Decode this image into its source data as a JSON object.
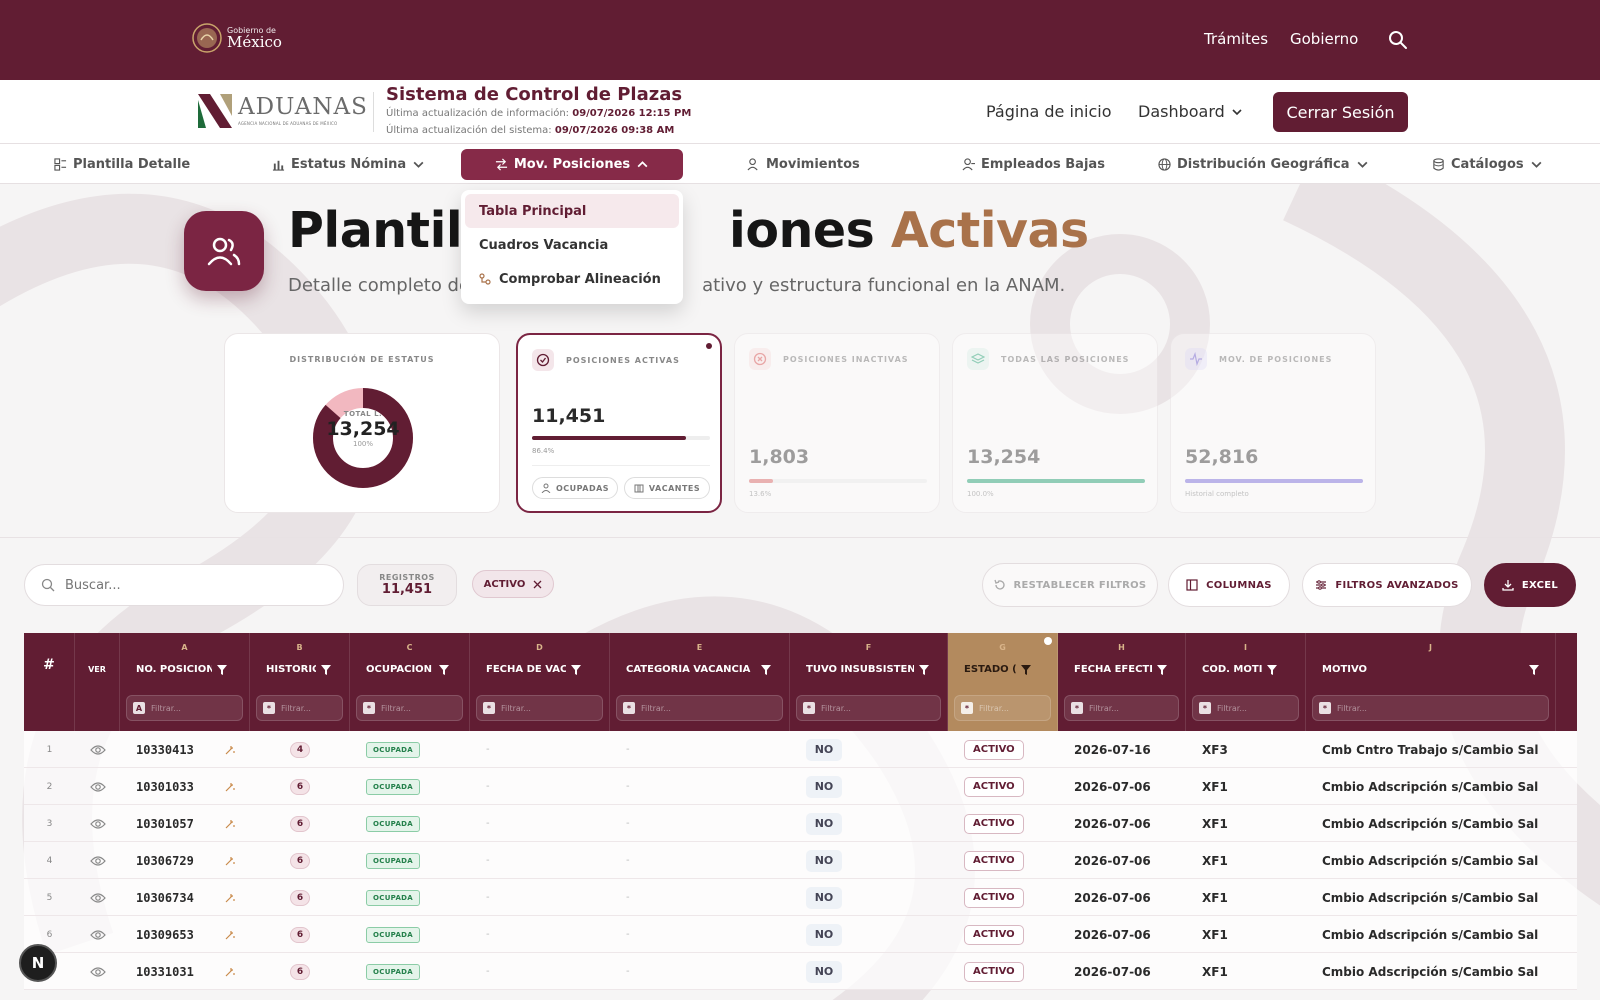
{
  "gov_bar": {
    "logo_small": "Gobierno de",
    "logo_big": "México",
    "links": [
      "Trámites",
      "Gobierno"
    ]
  },
  "header": {
    "logo_word": "ADUANAS",
    "logo_sub": "AGENCIA NACIONAL DE ADUANAS DE MÉXICO",
    "system_title": "Sistema de Control de Plazas",
    "update_info_label": "Última actualización de información:",
    "update_info_value": "09/07/2026 12:15 PM",
    "update_system_label": "Última actualización del sistema:",
    "update_system_value": "09/07/2026 09:38 AM",
    "home_link": "Página de inicio",
    "dashboard_link": "Dashboard",
    "logout": "Cerrar Sesión"
  },
  "nav": {
    "items": [
      {
        "label": "Plantilla Detalle",
        "icon": "list-detail-icon"
      },
      {
        "label": "Estatus Nómina",
        "icon": "bar-chart-icon"
      },
      {
        "label": "Mov. Posiciones",
        "icon": "arrows-swap-icon"
      },
      {
        "label": "Movimientos",
        "icon": "user-move-icon"
      },
      {
        "label": "Empleados Bajas",
        "icon": "user-minus-icon"
      },
      {
        "label": "Distribución Geográfica",
        "icon": "globe-icon"
      },
      {
        "label": "Catálogos",
        "icon": "database-icon"
      }
    ],
    "active": "Mov. Posiciones"
  },
  "dropdown": {
    "items": [
      "Tabla Principal",
      "Cuadros Vacancia",
      "Comprobar Alineación"
    ],
    "highlighted": "Tabla Principal"
  },
  "hero": {
    "title_visible_start": "Plantilla",
    "title_visible_end": "iones",
    "title_accent": "Activas",
    "subtitle_start": "Detalle completo de",
    "subtitle_end": "ativo y estructura funcional en la ANAM."
  },
  "cards": {
    "distribution": {
      "label": "DISTRIBUCIÓN DE ESTATUS",
      "center_label": "TOTAL L.",
      "center_value": "13,254",
      "center_pct": "100%",
      "active_fraction": 0.864
    },
    "active": {
      "label": "POSICIONES ACTIVAS",
      "value": "11,451",
      "pct": "86.4%",
      "fraction": 0.864,
      "chip_occupied": "OCUPADAS",
      "chip_vacant": "VACANTES"
    },
    "inactive": {
      "label": "POSICIONES INACTIVAS",
      "value": "1,803",
      "pct": "13.6%",
      "fraction": 0.136,
      "color": "#e07a7a"
    },
    "all": {
      "label": "TODAS LAS POSICIONES",
      "value": "13,254",
      "pct": "100.0%",
      "fraction": 1.0,
      "color": "#3fae86"
    },
    "movements": {
      "label": "MOV. DE POSICIONES",
      "value": "52,816",
      "note": "Historial completo",
      "fraction": 1.0,
      "color": "#8b7fe0"
    }
  },
  "toolbar": {
    "search_placeholder": "Buscar...",
    "records_label": "REGISTROS",
    "records_value": "11,451",
    "filter_chip": "ACTIVO",
    "reset": "RESTABLECER FILTROS",
    "columns": "COLUMNAS",
    "advanced": "FILTROS AVANZADOS",
    "excel": "EXCEL"
  },
  "table": {
    "hash": "#",
    "ver": "VER",
    "filter_placeholder": "Filtrar...",
    "columns": [
      {
        "letter": "A",
        "name": "NO. POSICIÓN"
      },
      {
        "letter": "B",
        "name": "HISTÓRIC"
      },
      {
        "letter": "C",
        "name": "OCUPACIÓN"
      },
      {
        "letter": "D",
        "name": "FECHA DE VACANC"
      },
      {
        "letter": "E",
        "name": "CATEGORÍA VACANCIA"
      },
      {
        "letter": "F",
        "name": "TUVO INSUBSISTENCI"
      },
      {
        "letter": "G",
        "name": "ESTADO (A/I"
      },
      {
        "letter": "H",
        "name": "FECHA EFECTIVA"
      },
      {
        "letter": "I",
        "name": "COD. MOTIVO"
      },
      {
        "letter": "J",
        "name": "MOTIVO"
      }
    ],
    "rows": [
      {
        "n": "1",
        "pos": "10330413",
        "hist": "4",
        "ocup": "OCUPADA",
        "fv": "-",
        "cat": "-",
        "insub": "NO",
        "estado": "ACTIVO",
        "fecha": "2026-07-16",
        "cod": "XF3",
        "motivo": "Cmb Cntro Trabajo s/Cambio Sal"
      },
      {
        "n": "2",
        "pos": "10301033",
        "hist": "6",
        "ocup": "OCUPADA",
        "fv": "-",
        "cat": "-",
        "insub": "NO",
        "estado": "ACTIVO",
        "fecha": "2026-07-06",
        "cod": "XF1",
        "motivo": "Cmbio Adscripción s/Cambio Sal"
      },
      {
        "n": "3",
        "pos": "10301057",
        "hist": "6",
        "ocup": "OCUPADA",
        "fv": "-",
        "cat": "-",
        "insub": "NO",
        "estado": "ACTIVO",
        "fecha": "2026-07-06",
        "cod": "XF1",
        "motivo": "Cmbio Adscripción s/Cambio Sal"
      },
      {
        "n": "4",
        "pos": "10306729",
        "hist": "6",
        "ocup": "OCUPADA",
        "fv": "-",
        "cat": "-",
        "insub": "NO",
        "estado": "ACTIVO",
        "fecha": "2026-07-06",
        "cod": "XF1",
        "motivo": "Cmbio Adscripción s/Cambio Sal"
      },
      {
        "n": "5",
        "pos": "10306734",
        "hist": "6",
        "ocup": "OCUPADA",
        "fv": "-",
        "cat": "-",
        "insub": "NO",
        "estado": "ACTIVO",
        "fecha": "2026-07-06",
        "cod": "XF1",
        "motivo": "Cmbio Adscripción s/Cambio Sal"
      },
      {
        "n": "6",
        "pos": "10309653",
        "hist": "6",
        "ocup": "OCUPADA",
        "fv": "-",
        "cat": "-",
        "insub": "NO",
        "estado": "ACTIVO",
        "fecha": "2026-07-06",
        "cod": "XF1",
        "motivo": "Cmbio Adscripción s/Cambio Sal"
      },
      {
        "n": "7",
        "pos": "10331031",
        "hist": "6",
        "ocup": "OCUPADA",
        "fv": "-",
        "cat": "-",
        "insub": "NO",
        "estado": "ACTIVO",
        "fecha": "2026-07-06",
        "cod": "XF1",
        "motivo": "Cmbio Adscripción s/Cambio Sal"
      }
    ]
  },
  "floating_badge": "N",
  "colors": {
    "brand": "#611d33",
    "accent": "#a9724a",
    "highlight_col": "#b38a5e"
  }
}
